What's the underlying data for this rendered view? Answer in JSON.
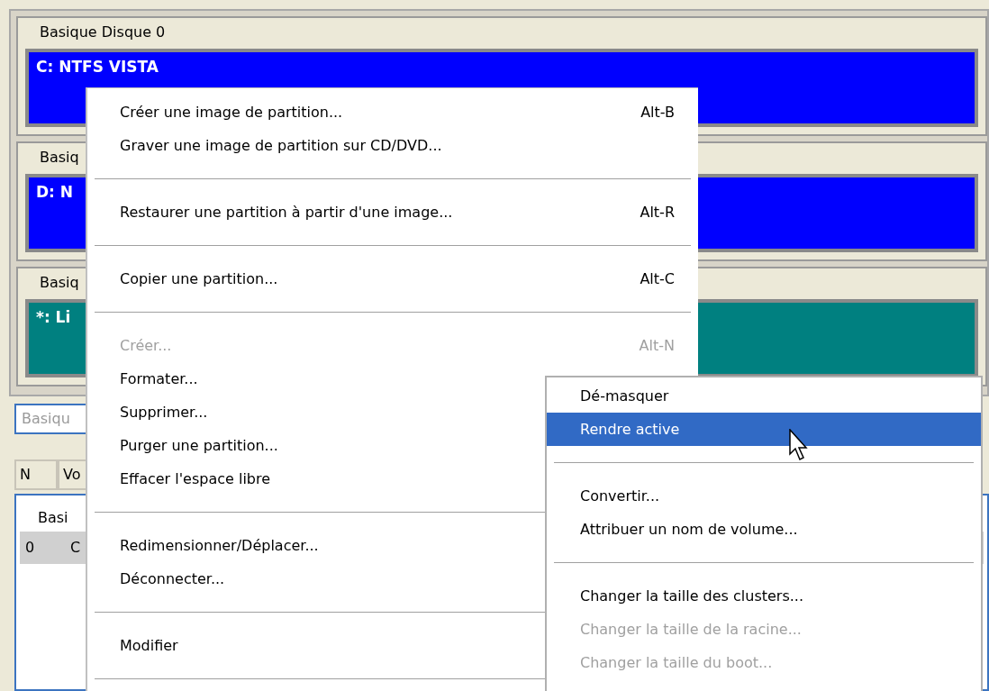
{
  "disks": [
    {
      "header": "Basique Disque 0",
      "partition": {
        "label": "C: NTFS VISTA",
        "color": "#0000ff"
      }
    },
    {
      "header": "Basiq",
      "partition": {
        "label": "D: N",
        "color": "#0000ff"
      }
    },
    {
      "header": "Basiq",
      "partition": {
        "label": "*: Li",
        "color": "#008080"
      }
    }
  ],
  "details": {
    "field": {
      "value": "Basiqu",
      "disabled": true
    },
    "columns": [
      "N",
      "Vo"
    ],
    "group": "Basi",
    "rows": [
      {
        "cells": [
          "0",
          "C"
        ],
        "selected": true
      }
    ]
  },
  "context_menu": {
    "items": [
      {
        "kind": "item",
        "label": "Créer une image de partition...",
        "shortcut": "Alt-B",
        "disabled": false
      },
      {
        "kind": "item",
        "label": "Graver une image de partition sur CD/DVD...",
        "disabled": false
      },
      {
        "kind": "separator"
      },
      {
        "kind": "item",
        "label": "Restaurer une partition à partir d'une image...",
        "shortcut": "Alt-R",
        "disabled": false
      },
      {
        "kind": "separator"
      },
      {
        "kind": "item",
        "label": "Copier une partition...",
        "shortcut": "Alt-C",
        "disabled": false
      },
      {
        "kind": "separator"
      },
      {
        "kind": "item",
        "label": "Créer...",
        "shortcut": "Alt-N",
        "disabled": true
      },
      {
        "kind": "item",
        "label": "Formater...",
        "disabled": false
      },
      {
        "kind": "item",
        "label": "Supprimer...",
        "disabled": false
      },
      {
        "kind": "item",
        "label": "Purger une partition...",
        "disabled": false
      },
      {
        "kind": "item",
        "label": "Effacer l'espace libre",
        "disabled": false
      },
      {
        "kind": "separator"
      },
      {
        "kind": "item",
        "label": "Redimensionner/Déplacer...",
        "disabled": false
      },
      {
        "kind": "item",
        "label": "Déconnecter...",
        "disabled": false
      },
      {
        "kind": "separator"
      },
      {
        "kind": "item",
        "label": "Modifier",
        "disabled": false
      },
      {
        "kind": "separator"
      }
    ]
  },
  "submenu": {
    "items": [
      {
        "kind": "item",
        "label": "Dé-masquer",
        "disabled": false,
        "selected": false
      },
      {
        "kind": "item",
        "label": "Rendre active",
        "disabled": false,
        "selected": true
      },
      {
        "kind": "separator"
      },
      {
        "kind": "item",
        "label": "Convertir...",
        "disabled": false,
        "selected": false
      },
      {
        "kind": "item",
        "label": "Attribuer un nom de volume...",
        "disabled": false,
        "selected": false
      },
      {
        "kind": "separator"
      },
      {
        "kind": "item",
        "label": "Changer la taille des clusters...",
        "disabled": false,
        "selected": false
      },
      {
        "kind": "item",
        "label": "Changer la taille de la racine...",
        "disabled": true,
        "selected": false
      },
      {
        "kind": "item",
        "label": "Changer la taille du boot...",
        "disabled": true,
        "selected": false
      }
    ]
  }
}
